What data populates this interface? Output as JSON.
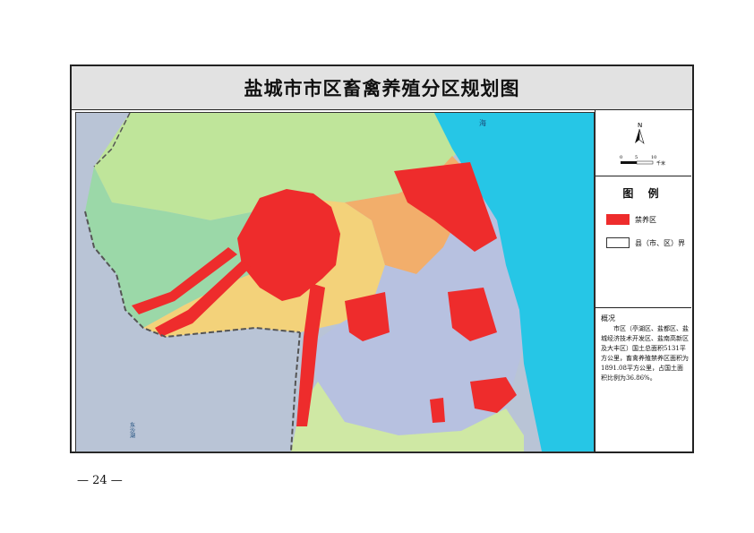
{
  "map": {
    "title": "盐城市市区畜禽养殖分区规划图",
    "sea_label": "海",
    "lake_label": "东沙湖",
    "colors": {
      "ban_zone": "#ee2c2c",
      "sea": "#26c6e6",
      "outer_land": "#b9c4d6",
      "north_west": "#bfe59a",
      "west_green": "#9bd8a8",
      "central_yellow": "#f3d27a",
      "orange": "#f2ae6b",
      "east_blue": "#b7c1e0",
      "south_green": "#cfe8a4",
      "boundary": "#555555"
    }
  },
  "compass": {
    "north_label": "N",
    "scale_ticks": [
      "0",
      "5",
      "10"
    ],
    "scale_unit": "千米"
  },
  "legend": {
    "title": "图  例",
    "items": [
      {
        "label": "禁养区",
        "color": "#ee2c2c"
      },
      {
        "label": "县（市、区）界",
        "color": "#ffffff"
      }
    ]
  },
  "notes": {
    "heading": "概况",
    "body": "市区（亭湖区、盐都区、盐城经济技术开发区、盐南高新区及大丰区）国土总面积5131平方公里，畜禽养殖禁养区面积为1891.08平方公里，占国土面积比例为36.86%。"
  },
  "page": {
    "number": "— 24 —"
  }
}
